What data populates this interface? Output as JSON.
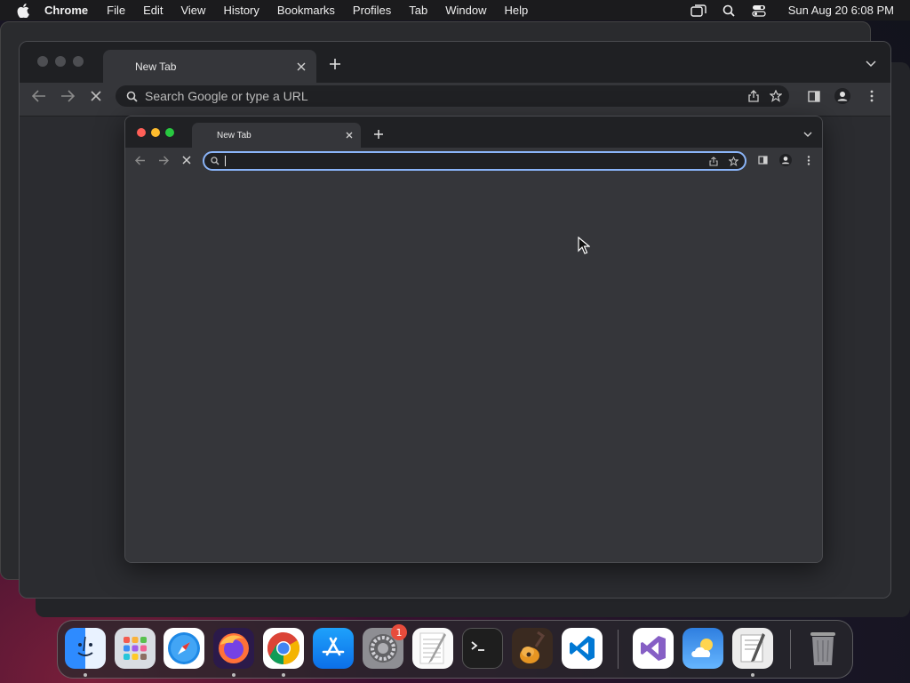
{
  "menubar": {
    "app_name": "Chrome",
    "items": [
      "File",
      "Edit",
      "View",
      "History",
      "Bookmarks",
      "Profiles",
      "Tab",
      "Window",
      "Help"
    ],
    "clock": "Sun Aug 20  6:08 PM"
  },
  "outer_window": {
    "tab_title": "New Tab",
    "omnibox_placeholder": "Search Google or type a URL"
  },
  "inner_window": {
    "tab_title": "New Tab",
    "omnibox_value": ""
  },
  "dock": {
    "apps": [
      "Finder",
      "Launchpad",
      "Safari",
      "Firefox",
      "Google Chrome",
      "App Store",
      "System Settings",
      "TextEdit",
      "Terminal",
      "GarageBand",
      "Visual Studio Code",
      "Visual Studio",
      "Weather",
      "Script Editor",
      "Trash"
    ],
    "settings_badge": "1"
  },
  "colors": {
    "accent_focus": "#8ab4f8",
    "close": "#ff5f57",
    "minimize": "#febc2e",
    "maximize": "#28c840"
  }
}
